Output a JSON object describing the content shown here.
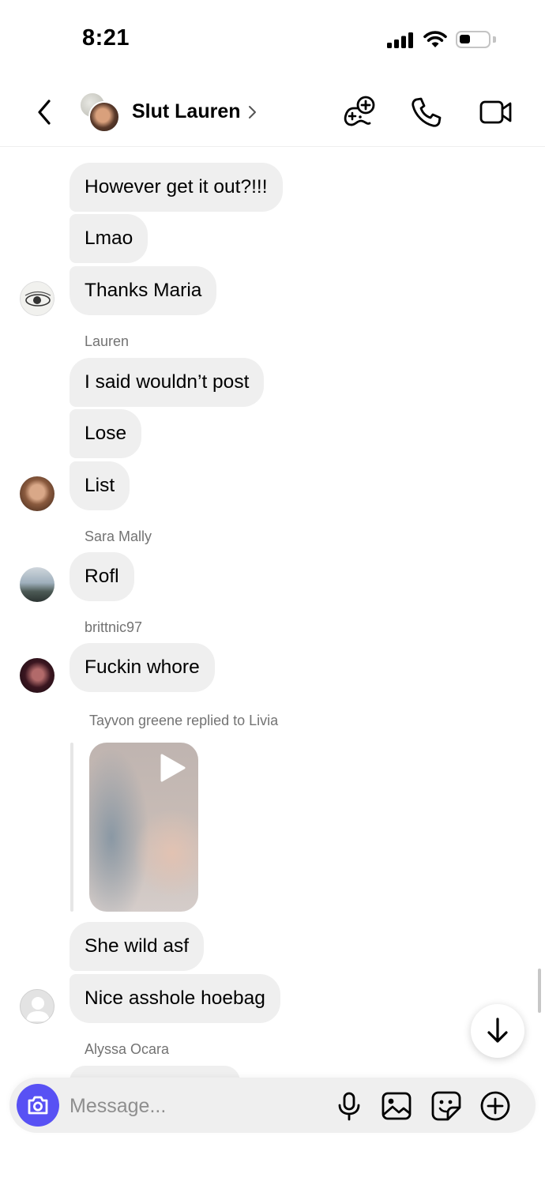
{
  "status_bar": {
    "time": "8:21"
  },
  "header": {
    "group_name": "Slut Lauren"
  },
  "messages": [
    {
      "text": "However get it out?!!!"
    },
    {
      "text": "Lmao"
    },
    {
      "text": "Thanks Maria"
    },
    {
      "sender": "Lauren"
    },
    {
      "text": "I said wouldn’t post"
    },
    {
      "text": "Lose"
    },
    {
      "text": "List"
    },
    {
      "sender": "Sara Mally"
    },
    {
      "text": "Rofl"
    },
    {
      "sender": "brittnic97"
    },
    {
      "text": "Fuckin whore"
    },
    {
      "reply_note": "Tayvon greene replied to Livia"
    },
    {
      "text": "She wild asf"
    },
    {
      "text": "Nice asshole hoebag"
    },
    {
      "sender": "Alyssa Ocara"
    }
  ],
  "composer": {
    "placeholder": "Message..."
  },
  "colors": {
    "bubble": "#efefef",
    "camera_accent": "#5851f4",
    "meta_text": "#737373"
  },
  "icons": [
    "back-chevron-icon",
    "game-controller-icon",
    "phone-icon",
    "video-camera-icon",
    "play-icon",
    "arrow-down-icon",
    "camera-icon",
    "microphone-icon",
    "gallery-icon",
    "sticker-icon",
    "plus-icon"
  ]
}
